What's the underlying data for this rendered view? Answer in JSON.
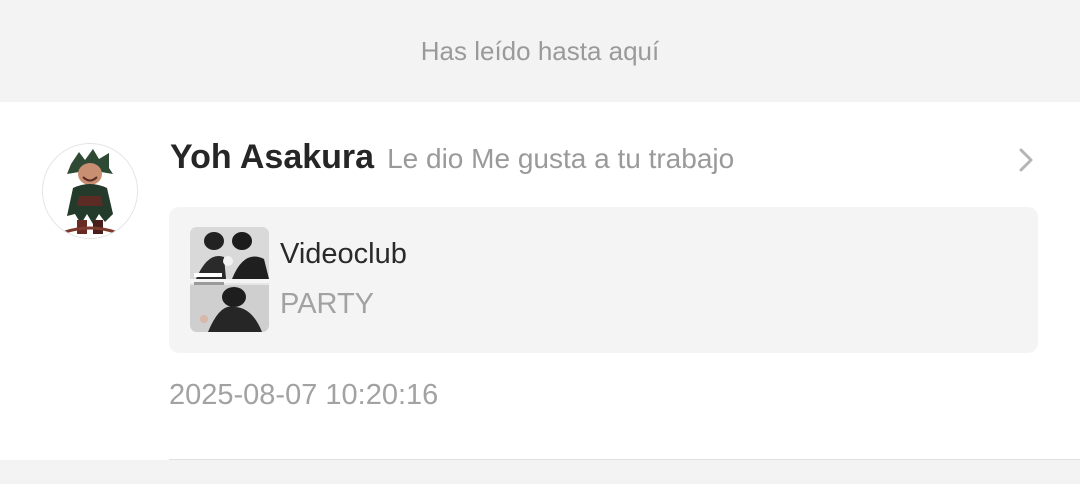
{
  "read_marker": {
    "text": "Has leído hasta aquí"
  },
  "notification": {
    "user_name": "Yoh Asakura",
    "action_text": "Le dio Me gusta a tu trabajo",
    "avatar_icon": "user-avatar",
    "chevron_icon": "chevron-right-icon",
    "work": {
      "title": "Videoclub",
      "subtitle": "PARTY",
      "thumbnail_icon": "work-thumbnail"
    },
    "timestamp": "2025-08-07 10:20:16"
  },
  "colors": {
    "background": "#f3f3f4",
    "card": "#ffffff",
    "work_card": "#f4f4f5",
    "muted_text": "#9a9a9a",
    "primary_text": "#262626"
  }
}
